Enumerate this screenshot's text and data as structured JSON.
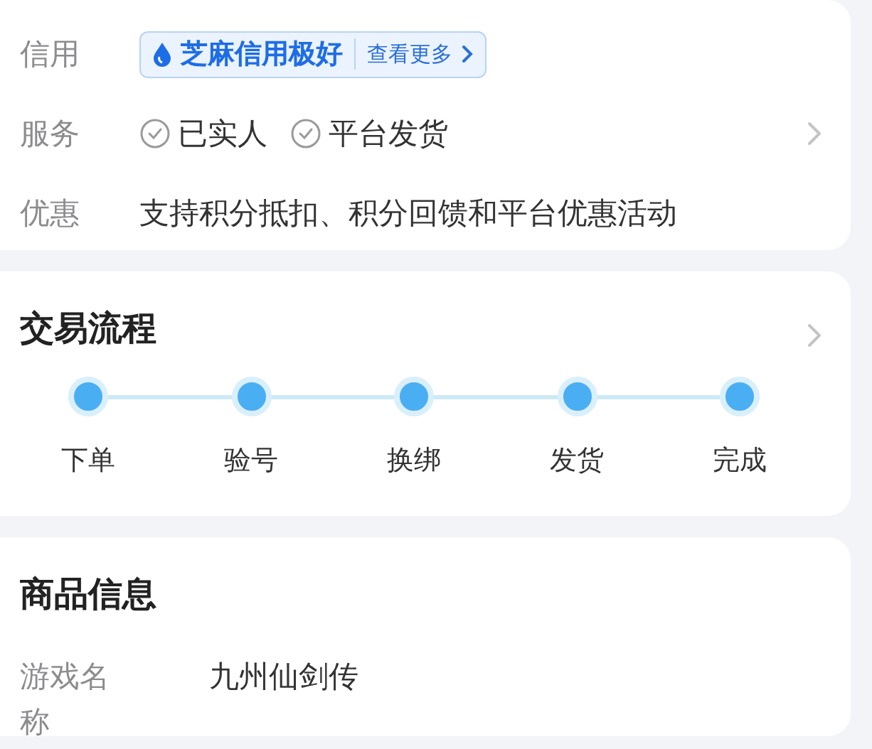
{
  "credit": {
    "label": "信用",
    "badge": "芝麻信用极好",
    "more": "查看更多"
  },
  "service": {
    "label": "服务",
    "items": [
      "已实人",
      "平台发货"
    ]
  },
  "discount": {
    "label": "优惠",
    "text": "支持积分抵扣、积分回馈和平台优惠活动"
  },
  "process": {
    "title": "交易流程",
    "steps": [
      {
        "label": "下单"
      },
      {
        "label": "验号"
      },
      {
        "label": "换绑"
      },
      {
        "label": "发货"
      },
      {
        "label": "完成"
      }
    ]
  },
  "goods": {
    "title": "商品信息",
    "rows": [
      {
        "label": "游戏名称",
        "value": "九州仙剑传"
      }
    ]
  }
}
